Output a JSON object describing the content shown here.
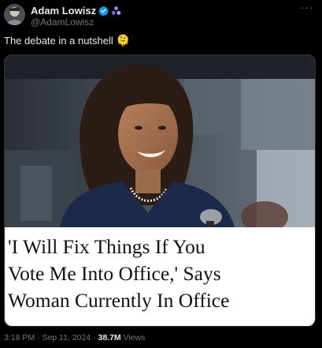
{
  "author": {
    "display_name": "Adam Lowisz",
    "handle": "@AdamLowisz",
    "verified_color": "#1d9bf0",
    "affiliate_color": "#a67cff"
  },
  "tweet": {
    "text": "The debate in a nutshell",
    "emoji": "🫠"
  },
  "media": {
    "headline_line1": "'I Will Fix Things If You",
    "headline_line2": "Vote Me Into Office,' Says",
    "headline_line3": "Woman Currently In Office"
  },
  "meta": {
    "time": "3:18 PM",
    "date": "Sep 11, 2024",
    "separator": "·",
    "views_count": "38.7M",
    "views_label": "Views"
  },
  "icons": {
    "more": "more-icon",
    "verified": "verified-icon",
    "affiliate": "affiliate-icon"
  }
}
